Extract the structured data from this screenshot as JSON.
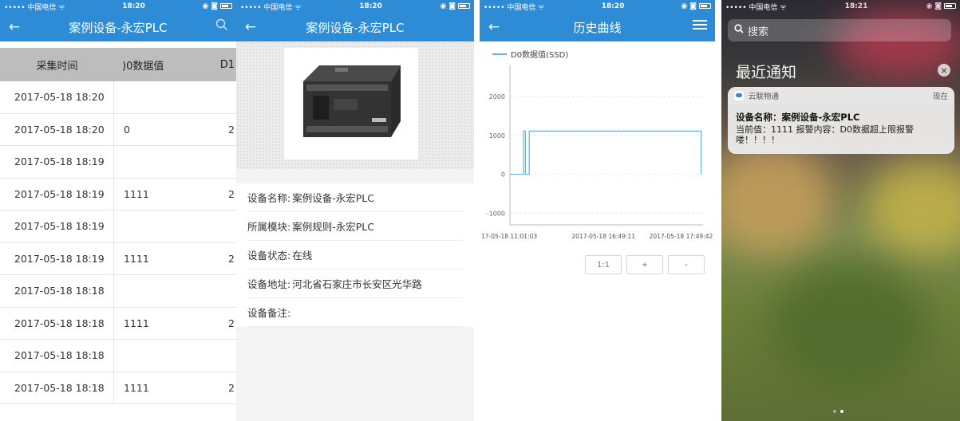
{
  "status": {
    "carrier": "••••• 中国电信 ",
    "wifi": "ᯤ",
    "time1": "18:20",
    "time2": "18:20",
    "time3": "18:20",
    "time4": "18:21",
    "icons": "◉ ◙"
  },
  "screen1": {
    "title": "案例设备-永宏PLC",
    "columns": [
      "采集时间",
      ")0数据值",
      "D1"
    ],
    "rows": [
      {
        "time": "2017-05-18 18:20",
        "val": "",
        "d1": ""
      },
      {
        "time": "2017-05-18 18:20",
        "val": "0",
        "d1": "2"
      },
      {
        "time": "2017-05-18 18:19",
        "val": "",
        "d1": ""
      },
      {
        "time": "2017-05-18 18:19",
        "val": "1111",
        "d1": "2"
      },
      {
        "time": "2017-05-18 18:19",
        "val": "",
        "d1": ""
      },
      {
        "time": "2017-05-18 18:19",
        "val": "1111",
        "d1": "2"
      },
      {
        "time": "2017-05-18 18:18",
        "val": "",
        "d1": ""
      },
      {
        "time": "2017-05-18 18:18",
        "val": "1111",
        "d1": "2"
      },
      {
        "time": "2017-05-18 18:18",
        "val": "",
        "d1": ""
      },
      {
        "time": "2017-05-18 18:18",
        "val": "1111",
        "d1": "2"
      }
    ]
  },
  "screen2": {
    "title": "案例设备-永宏PLC",
    "details": [
      {
        "label": "设备名称:",
        "value": "案例设备-永宏PLC"
      },
      {
        "label": "所属模块:",
        "value": "案例规则-永宏PLC"
      },
      {
        "label": "设备状态:",
        "value": "在线"
      },
      {
        "label": "设备地址:",
        "value": "河北省石家庄市长安区光华路"
      },
      {
        "label": "设备备注:",
        "value": ""
      }
    ]
  },
  "screen3": {
    "title": "历史曲线",
    "zoom_buttons": [
      "1:1",
      "+",
      "-"
    ]
  },
  "chart_data": {
    "type": "line",
    "title": "",
    "series": [
      {
        "name": "D0数据值(SSD)",
        "color": "#6aaee0",
        "points": [
          [
            0,
            0
          ],
          [
            0.07,
            0
          ],
          [
            0.07,
            1111
          ],
          [
            0.08,
            1111
          ],
          [
            0.08,
            0
          ],
          [
            0.1,
            0
          ],
          [
            0.1,
            1111
          ],
          [
            0.99,
            1111
          ],
          [
            0.99,
            0
          ]
        ]
      }
    ],
    "yticks": [
      2000,
      1000,
      0,
      -1000
    ],
    "ylim": [
      -1300,
      2800
    ],
    "xtick_labels": [
      "17-05-18 11:01:03",
      "2017-05-18 16:49:11",
      "2017-05-18 17:49:42"
    ],
    "grid": true
  },
  "screen4": {
    "search_placeholder": "搜索",
    "recent_title": "最近通知",
    "clear_symbol": "×",
    "notification": {
      "app": "云联物通",
      "when": "现在",
      "title": "设备名称：案例设备-永宏PLC",
      "body": "当前值：1111 报警内容：D0数据超上限报警喽！！！！"
    }
  }
}
